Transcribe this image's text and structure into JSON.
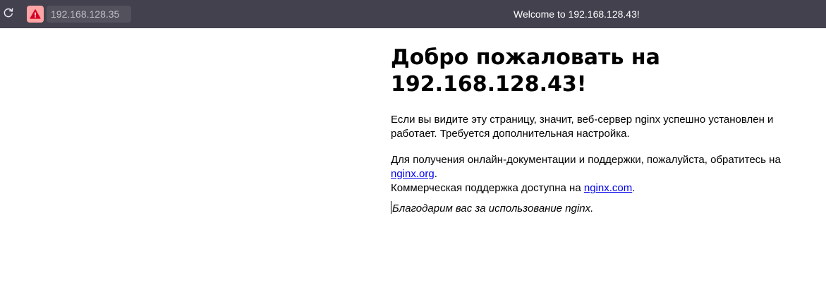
{
  "browser": {
    "url": "192.168.128.35",
    "tab_title": "Welcome to 192.168.128.43!",
    "warning_color": "#ffa5a5",
    "toolbar_color": "#42414d",
    "icons": [
      "reload-icon",
      "warning-icon"
    ]
  },
  "page": {
    "heading": "Добро пожаловать на 192.168.128.43!",
    "para1": "Если вы видите эту страницу, значит, веб-сервер nginx успешно установлен и работает. Требуется дополнительная настройка.",
    "para2_text": "Для получения онлайн-документации и поддержки, пожалуйста, обратитесь на ",
    "link_org": "nginx.org",
    "para2_mid": ".",
    "para2_line2": "Коммерческая поддержка доступна на ",
    "link_com": "nginx.com",
    "para2_end": ".",
    "thanks": "Благодарим вас за использование nginx."
  }
}
